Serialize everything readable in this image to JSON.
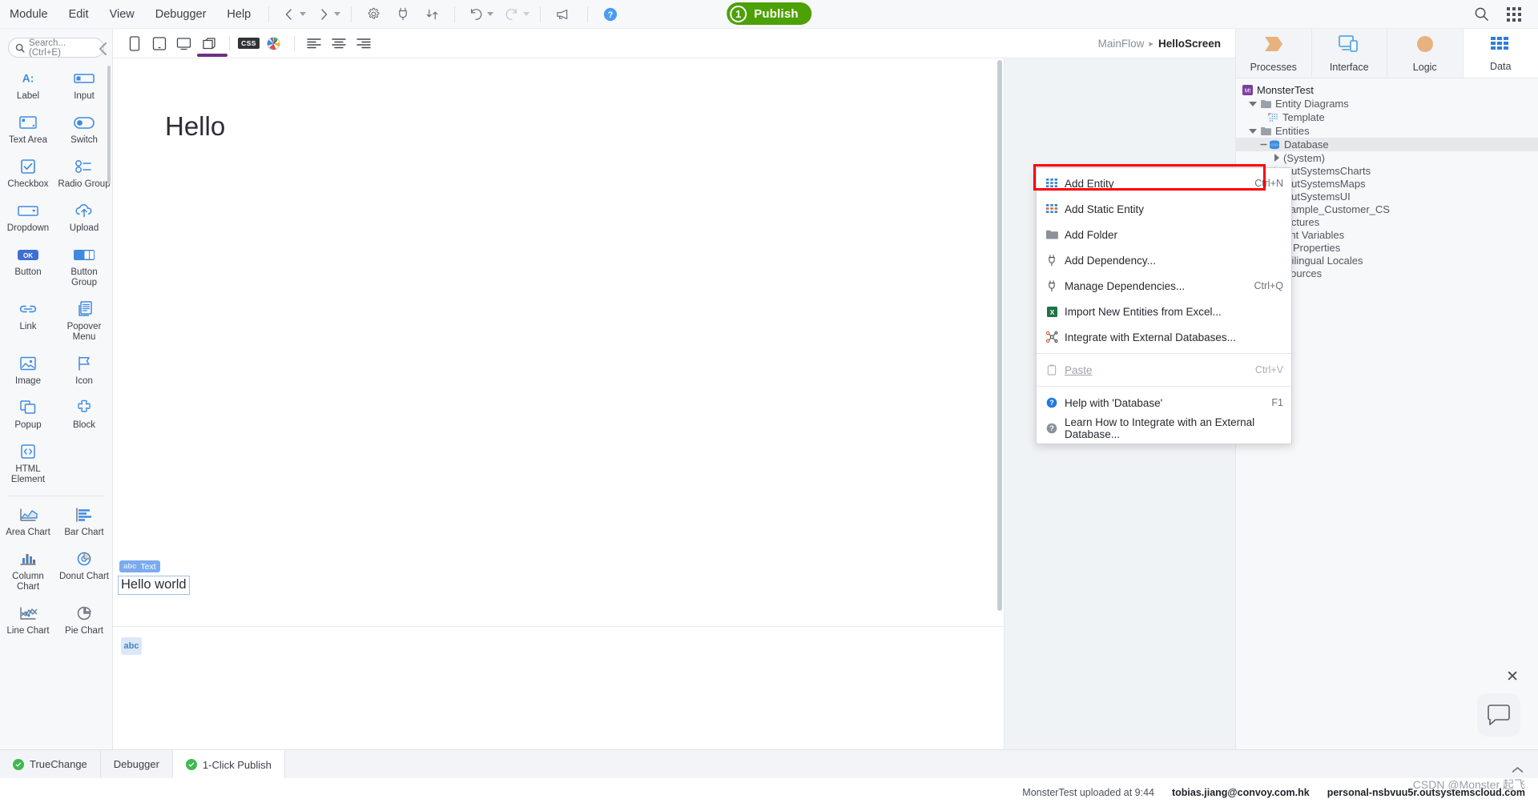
{
  "menubar": {
    "items": [
      "Module",
      "Edit",
      "View",
      "Debugger",
      "Help"
    ],
    "nav_back_name": "back-icon",
    "nav_forward_name": "forward-icon",
    "publish": {
      "badge": "1",
      "label": "Publish",
      "color": "#4ca104"
    },
    "right_icons": [
      "search-icon",
      "grid-apps-icon"
    ]
  },
  "toolbox": {
    "search_placeholder": "Search... (Ctrl+E)",
    "widgets": [
      {
        "label": "Label",
        "icon": "label-icon"
      },
      {
        "label": "Input",
        "icon": "input-icon"
      },
      {
        "label": "Text Area",
        "icon": "textarea-icon"
      },
      {
        "label": "Switch",
        "icon": "switch-icon"
      },
      {
        "label": "Checkbox",
        "icon": "checkbox-icon"
      },
      {
        "label": "Radio Group",
        "icon": "radio-group-icon"
      },
      {
        "label": "Dropdown",
        "icon": "dropdown-icon"
      },
      {
        "label": "Upload",
        "icon": "upload-icon"
      },
      {
        "label": "Button",
        "icon": "button-icon"
      },
      {
        "label": "Button Group",
        "icon": "button-group-icon"
      },
      {
        "label": "Link",
        "icon": "link-icon"
      },
      {
        "label": "Popover Menu",
        "icon": "popover-menu-icon"
      },
      {
        "label": "Image",
        "icon": "image-icon"
      },
      {
        "label": "Icon",
        "icon": "flag-icon"
      },
      {
        "label": "Popup",
        "icon": "popup-icon"
      },
      {
        "label": "Block",
        "icon": "block-icon"
      },
      {
        "label": "HTML Element",
        "icon": "html-element-icon"
      }
    ],
    "charts": [
      {
        "label": "Area Chart",
        "icon": "area-chart-icon"
      },
      {
        "label": "Bar Chart",
        "icon": "bar-chart-icon"
      },
      {
        "label": "Column Chart",
        "icon": "column-chart-icon"
      },
      {
        "label": "Donut Chart",
        "icon": "donut-chart-icon"
      },
      {
        "label": "Line Chart",
        "icon": "line-chart-icon"
      },
      {
        "label": "Pie Chart",
        "icon": "pie-chart-icon"
      }
    ]
  },
  "editor_toolbar": {
    "icons": [
      "phone-icon",
      "tablet-icon",
      "desktop-icon",
      "layers-icon",
      "css-icon",
      "theme-icon",
      "align-left-icon",
      "align-center-icon",
      "align-right-icon"
    ],
    "css_chip": "CSS"
  },
  "breadcrumb": {
    "parent": "MainFlow",
    "separator": "▸",
    "current": "HelloScreen"
  },
  "canvas": {
    "heading": "Hello",
    "widget_tag_abc": "abc",
    "widget_tag_name": "Text",
    "body_text": "Hello world",
    "placeholder_abc": "abc"
  },
  "rightpanel": {
    "tabs": [
      {
        "label": "Processes",
        "icon": "processes-icon",
        "active": false
      },
      {
        "label": "Interface",
        "icon": "interface-icon",
        "active": false
      },
      {
        "label": "Logic",
        "icon": "logic-icon",
        "active": false
      },
      {
        "label": "Data",
        "icon": "data-icon",
        "active": true
      }
    ],
    "tree": [
      {
        "label": "MonsterTest",
        "indent": 0,
        "caret": "none",
        "icon": "module-icon",
        "kind": "module"
      },
      {
        "label": "Entity Diagrams",
        "indent": 1,
        "caret": "open",
        "icon": "folder-icon",
        "kind": "folder"
      },
      {
        "label": "Template",
        "indent": 2,
        "caret": "none",
        "icon": "diagram-icon",
        "kind": "item"
      },
      {
        "label": "Entities",
        "indent": 1,
        "caret": "open",
        "icon": "folder-icon",
        "kind": "folder"
      },
      {
        "label": "Database",
        "indent": 2,
        "caret": "open",
        "icon": "database-icon",
        "kind": "item",
        "selected": true
      },
      {
        "label": "(System)",
        "indent": 3,
        "caret": "closed",
        "icon": "none",
        "kind": "item"
      },
      {
        "label": "OutSystemsCharts",
        "indent": 3,
        "caret": "closed",
        "icon": "none",
        "kind": "item"
      },
      {
        "label": "OutSystemsMaps",
        "indent": 3,
        "caret": "closed",
        "icon": "none",
        "kind": "item"
      },
      {
        "label": "OutSystemsUI",
        "indent": 3,
        "caret": "closed",
        "icon": "none",
        "kind": "item"
      },
      {
        "label": "Sample_Customer_CS",
        "indent": 3,
        "caret": "closed",
        "icon": "none",
        "kind": "item"
      },
      {
        "label": "Structures",
        "indent": 1,
        "caret": "closed",
        "icon": "folder-icon",
        "kind": "folder"
      },
      {
        "label": "Client Variables",
        "indent": 1,
        "caret": "closed",
        "icon": "folder-icon",
        "kind": "folder"
      },
      {
        "label": "Site Properties",
        "indent": 1,
        "caret": "closed",
        "icon": "folder-icon",
        "kind": "folder"
      },
      {
        "label": "Multilingual Locales",
        "indent": 1,
        "caret": "closed",
        "icon": "folder-icon",
        "kind": "folder"
      },
      {
        "label": "Resources",
        "indent": 1,
        "caret": "closed",
        "icon": "folder-icon",
        "kind": "folder"
      }
    ]
  },
  "context_menu": {
    "highlighted_index": 0,
    "items": [
      {
        "label": "Add Entity",
        "shortcut": "Ctrl+N",
        "icon": "entity-icon",
        "disabled": false,
        "type": "item"
      },
      {
        "label": "Add Static Entity",
        "shortcut": "",
        "icon": "static-entity-icon",
        "disabled": false,
        "type": "item"
      },
      {
        "label": "Add Folder",
        "shortcut": "",
        "icon": "folder-icon",
        "disabled": false,
        "type": "item"
      },
      {
        "label": "Add Dependency...",
        "shortcut": "",
        "icon": "plug-icon",
        "disabled": false,
        "type": "item"
      },
      {
        "label": "Manage Dependencies...",
        "shortcut": "Ctrl+Q",
        "icon": "plug-icon",
        "disabled": false,
        "type": "item",
        "underline_at": 7
      },
      {
        "label": "Import New Entities from Excel...",
        "shortcut": "",
        "icon": "excel-icon",
        "disabled": false,
        "type": "item",
        "underline_at": 27
      },
      {
        "label": "Integrate with External Databases...",
        "shortcut": "",
        "icon": "integrate-icon",
        "disabled": false,
        "type": "item"
      },
      {
        "type": "separator"
      },
      {
        "label": "Paste",
        "shortcut": "Ctrl+V",
        "icon": "paste-icon",
        "disabled": true,
        "type": "item",
        "underline_at": 0
      },
      {
        "type": "separator"
      },
      {
        "label": "Help with 'Database'",
        "shortcut": "F1",
        "icon": "help-blue-icon",
        "disabled": false,
        "type": "item"
      },
      {
        "label": "Learn How to Integrate with an External Database...",
        "shortcut": "",
        "icon": "help-gray-icon",
        "disabled": false,
        "type": "item"
      }
    ]
  },
  "bottombar": {
    "tabs": [
      {
        "label": "TrueChange",
        "status": "ok",
        "active": false
      },
      {
        "label": "Debugger",
        "status": "none",
        "active": false
      },
      {
        "label": "1-Click Publish",
        "status": "ok",
        "active": true
      }
    ]
  },
  "statusbar": {
    "upload_text": "MonsterTest uploaded at 9:44",
    "user_email": "tobias.jiang@convoy.com.hk",
    "environment": "personal-nsbvuu5r.outsystemscloud.com"
  },
  "watermark": "CSDN @Monster 起飞"
}
